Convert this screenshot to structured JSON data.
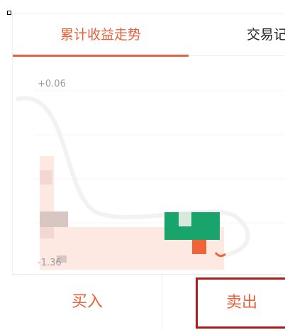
{
  "tabs": {
    "cumulative_label": "累计收益走势",
    "trade_label": "交易记"
  },
  "chart_data": {
    "type": "line",
    "yticks": [
      "+0.06",
      "-1.36"
    ],
    "ylim": [
      -1.36,
      0.06
    ],
    "grid": true,
    "colors": {
      "area_fill": "#fde9e2",
      "pixel_light": "#f3d7d0",
      "pixel_mid": "#d8c6c2",
      "positive_bar": "#19a46c",
      "negative_bar": "#f0643a"
    }
  },
  "actions": {
    "buy_label": "买入",
    "sell_label": "卖出"
  },
  "colors": {
    "accent": "#e8603c",
    "highlight_border": "#a91d1d"
  }
}
